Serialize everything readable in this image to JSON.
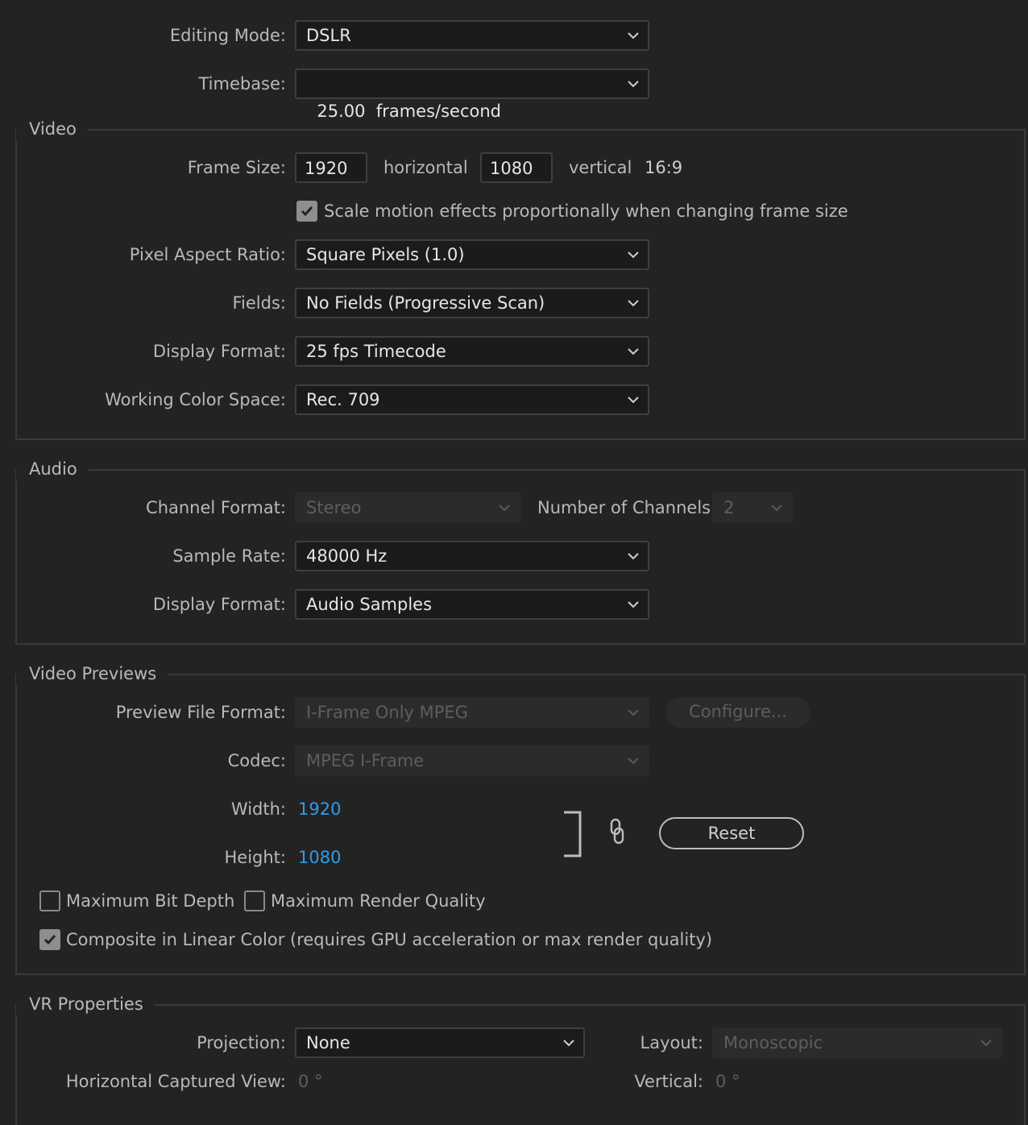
{
  "general": {
    "editing_mode_label": "Editing Mode:",
    "editing_mode_value": "DSLR",
    "timebase_label": "Timebase:",
    "timebase_value": "25.00  frames/second"
  },
  "video": {
    "title": "Video",
    "frame_size_label": "Frame Size:",
    "width_value": "1920",
    "horizontal_label": "horizontal",
    "height_value": "1080",
    "vertical_label": "vertical",
    "aspect": "16:9",
    "scale_motion_label": "Scale motion effects proportionally when changing frame size",
    "scale_motion_checked": true,
    "par_label": "Pixel Aspect Ratio:",
    "par_value": "Square Pixels (1.0)",
    "fields_label": "Fields:",
    "fields_value": "No Fields (Progressive Scan)",
    "display_format_label": "Display Format:",
    "display_format_value": "25 fps Timecode",
    "color_space_label": "Working Color Space:",
    "color_space_value": "Rec. 709"
  },
  "audio": {
    "title": "Audio",
    "channel_format_label": "Channel Format:",
    "channel_format_value": "Stereo",
    "num_channels_label": "Number of Channels:",
    "num_channels_value": "2",
    "sample_rate_label": "Sample Rate:",
    "sample_rate_value": "48000 Hz",
    "display_format_label": "Display Format:",
    "display_format_value": "Audio Samples"
  },
  "previews": {
    "title": "Video Previews",
    "file_format_label": "Preview File Format:",
    "file_format_value": "I-Frame Only MPEG",
    "configure_label": "Configure...",
    "codec_label": "Codec:",
    "codec_value": "MPEG I-Frame",
    "width_label": "Width:",
    "width_value": "1920",
    "height_label": "Height:",
    "height_value": "1080",
    "reset_label": "Reset",
    "max_bit_depth_label": "Maximum Bit Depth",
    "max_render_quality_label": "Maximum Render Quality",
    "composite_linear_label": "Composite in Linear Color (requires GPU acceleration or max render quality)"
  },
  "vr": {
    "title": "VR Properties",
    "projection_label": "Projection:",
    "projection_value": "None",
    "layout_label": "Layout:",
    "layout_value": "Monoscopic",
    "h_view_label": "Horizontal Captured View:",
    "h_view_value": "0 °",
    "vertical_label": "Vertical:",
    "vertical_value": "0 °"
  },
  "colors": {
    "background": "#232323",
    "link_blue": "#2f9ce8"
  }
}
